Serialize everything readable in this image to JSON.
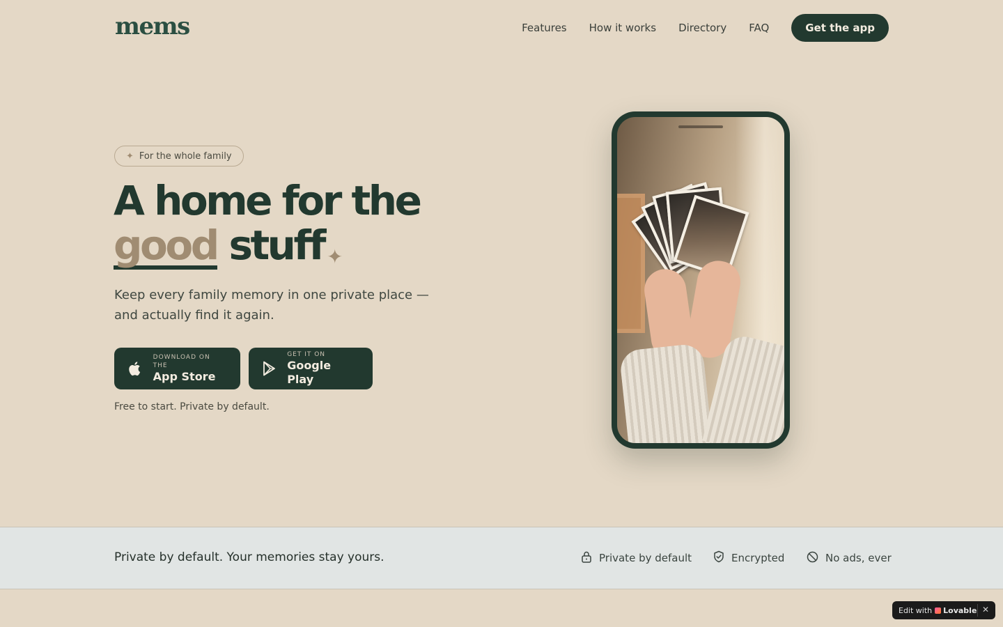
{
  "header": {
    "logo": "mems",
    "nav": [
      "Features",
      "How it works",
      "Directory",
      "FAQ"
    ],
    "cta": "Get the app"
  },
  "hero": {
    "badge": "For the whole family",
    "headline_line1": "A home for the",
    "headline_highlight": "good",
    "headline_rest": "stuff",
    "subtitle": "Keep every family memory in one private place — and actually find it again.",
    "app_store": {
      "small": "DOWNLOAD ON THE",
      "big": "App Store"
    },
    "google_play": {
      "small": "GET IT ON",
      "big": "Google Play"
    },
    "note": "Free to start. Private by default."
  },
  "trust_band": {
    "tagline": "Private by default. Your memories stay yours.",
    "items": [
      {
        "icon": "lock-icon",
        "label": "Private by default"
      },
      {
        "icon": "shield-check-icon",
        "label": "Encrypted"
      },
      {
        "icon": "no-ads-icon",
        "label": "No ads, ever"
      }
    ]
  },
  "lovable_badge": {
    "prefix": "Edit with",
    "brand": "Lovable"
  },
  "colors": {
    "background": "#e4d8c6",
    "primary": "#22392f",
    "accent": "#a08c72",
    "band": "#e1e5e4"
  }
}
